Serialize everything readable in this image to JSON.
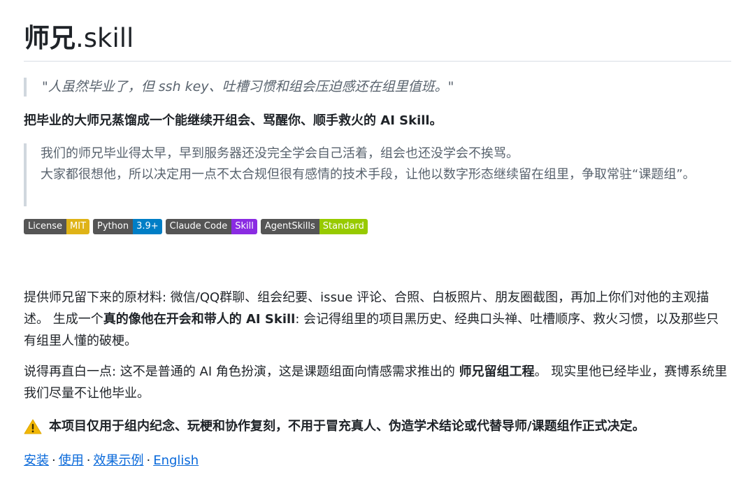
{
  "heading": {
    "title_cn": "师兄",
    "title_ascii": ".skill"
  },
  "quote": "\"人虽然毕业了，但 ssh key、吐槽习惯和组会压迫感还在组里值班。\"",
  "lead": "把毕业的大师兄蒸馏成一个能继续开组会、骂醒你、顺手救火的 AI Skill。",
  "intro_quote": {
    "line1": "我们的师兄毕业得太早，早到服务器还没完全学会自己活着，组会也还没学会不挨骂。",
    "line2": "大家都很想他，所以决定用一点不太合规但很有感情的技术手段，让他以数字形态继续留在组里，争取常驻“课题组”。"
  },
  "badges": [
    {
      "label": "License",
      "value": "MIT",
      "color": "#dfb317"
    },
    {
      "label": "Python",
      "value": "3.9+",
      "color": "#007ec6"
    },
    {
      "label": "Claude Code",
      "value": "Skill",
      "color": "#8a2be2"
    },
    {
      "label": "AgentSkills",
      "value": "Standard",
      "color": "#97ca00"
    }
  ],
  "para1": {
    "before": "提供师兄留下来的原材料: 微信/QQ群聊、组会纪要、issue 评论、合照、白板照片、朋友圈截图，再加上你们对他的主观描述。 生成一个",
    "bold": "真的像他在开会和带人的 AI Skill",
    "after": ": 会记得组里的项目黑历史、经典口头禅、吐槽顺序、救火习惯，以及那些只有组里人懂的破梗。"
  },
  "para2": {
    "before": "说得再直白一点: 这不是普通的 AI 角色扮演，这是课题组面向情感需求推出的 ",
    "bold": "师兄留组工程",
    "after": "。 现实里他已经毕业，赛博系统里我们尽量不让他毕业。"
  },
  "warning": {
    "icon": "warning-icon",
    "text": "本项目仅用于组内纪念、玩梗和协作复刻，不用于冒充真人、伪造学术结论或代替导师/课题组作正式决定。"
  },
  "nav_links": [
    "安装",
    "使用",
    "效果示例",
    "English"
  ],
  "nav_separator": "·",
  "colors": {
    "link": "#0969da",
    "text": "#1f2328",
    "muted": "#59636e",
    "quote_border": "#d0d7de"
  }
}
